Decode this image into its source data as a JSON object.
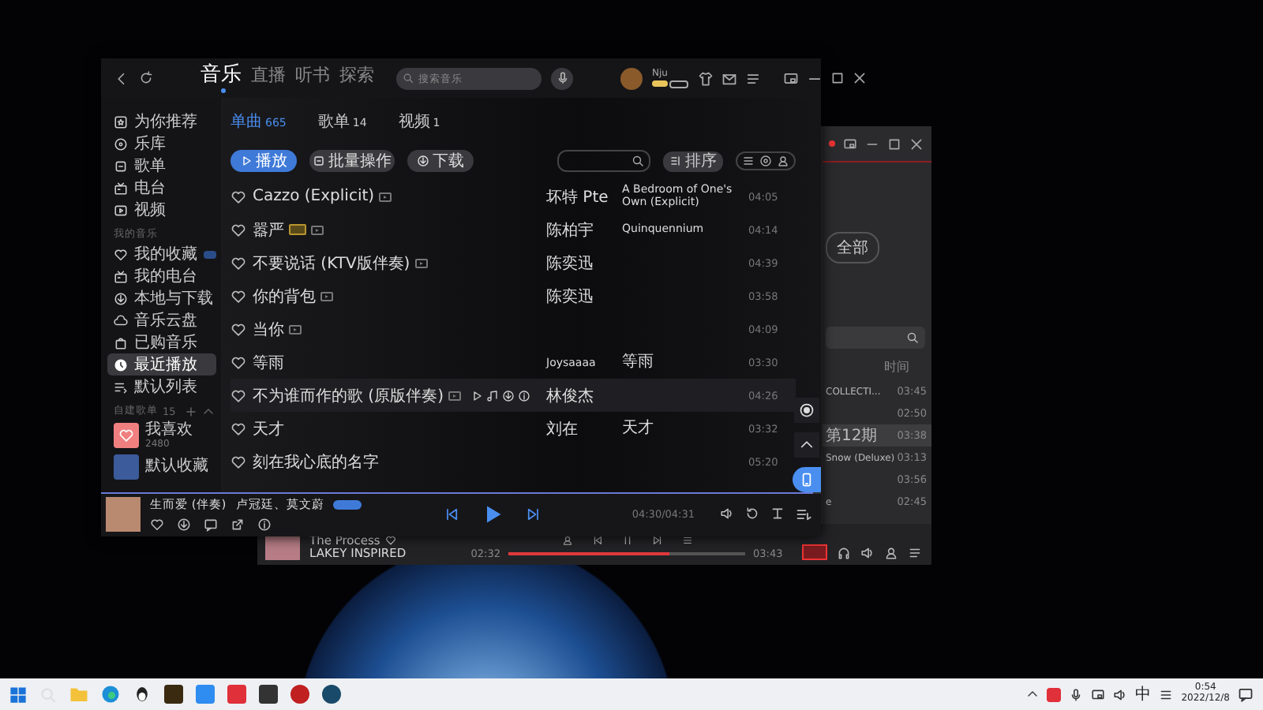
{
  "main_window": {
    "nav_tabs": [
      {
        "label": "音乐",
        "selected": true
      },
      {
        "label": "直播",
        "selected": false
      },
      {
        "label": "听书",
        "selected": false
      },
      {
        "label": "探索",
        "selected": false
      }
    ],
    "search": {
      "placeholder": "搜索音乐"
    },
    "user": {
      "name": "Nju"
    },
    "sidebar": {
      "groups": [
        {
          "items": [
            {
              "label": "为你推荐",
              "kind": "recommend",
              "selected": false
            },
            {
              "label": "乐库",
              "kind": "library",
              "selected": false
            },
            {
              "label": "歌单",
              "kind": "playlist",
              "selected": false
            },
            {
              "label": "电台",
              "kind": "radio",
              "selected": false
            },
            {
              "label": "视频",
              "kind": "video",
              "selected": false
            }
          ]
        },
        {
          "title": "我的音乐",
          "items": [
            {
              "label": "我的收藏",
              "kind": "favorite",
              "selected": false
            },
            {
              "label": "我的电台",
              "kind": "radio",
              "selected": false
            },
            {
              "label": "本地与下载",
              "kind": "download",
              "selected": false
            },
            {
              "label": "音乐云盘",
              "kind": "cloud",
              "selected": false
            },
            {
              "label": "已购音乐",
              "kind": "purchased",
              "selected": false
            },
            {
              "label": "最近播放",
              "kind": "recent",
              "selected": true
            },
            {
              "label": "默认列表",
              "kind": "list",
              "selected": false
            }
          ]
        }
      ],
      "playlists": {
        "title": "自建歌单",
        "count": "15",
        "items": [
          {
            "name": "我喜欢",
            "count": "2480",
            "kind": "liked"
          },
          {
            "name": "默认收藏",
            "kind": "default"
          }
        ]
      }
    },
    "content_tabs": [
      {
        "label": "单曲",
        "count": "665",
        "selected": true
      },
      {
        "label": "歌单",
        "count": "14",
        "selected": false
      },
      {
        "label": "视频",
        "count": "1",
        "selected": false
      }
    ],
    "actions": [
      {
        "label": "播放",
        "kind": "primary"
      },
      {
        "label": "批量操作",
        "kind": "batch"
      },
      {
        "label": "下载",
        "kind": "download"
      }
    ],
    "sort_button": "排序",
    "rows": [
      {
        "title": "Cazzo (Explicit)",
        "mv": true,
        "sq": false,
        "artist": "坏特 Pte",
        "album": "A Bedroom of One's Own (Explicit)",
        "duration": "04:05",
        "hovered": false
      },
      {
        "title": "嚣严",
        "mv": true,
        "sq": true,
        "artist": "陈柏宇",
        "album": "Quinquennium",
        "duration": "04:14",
        "hovered": false
      },
      {
        "title": "不要说话 (KTV版伴奏)",
        "mv": true,
        "sq": false,
        "artist": "陈奕迅",
        "duration": "04:39",
        "hovered": false
      },
      {
        "title": "你的背包",
        "mv": true,
        "sq": false,
        "artist": "陈奕迅",
        "duration": "03:58",
        "hovered": false
      },
      {
        "title": "当你",
        "mv": true,
        "sq": false,
        "duration": "04:09",
        "hovered": false
      },
      {
        "title": "等雨",
        "mv": false,
        "sq": false,
        "artist": "Joysaaaa",
        "album": "等雨",
        "duration": "03:30",
        "hovered": false
      },
      {
        "title": "不为谁而作的歌 (原版伴奏)",
        "mv": true,
        "sq": false,
        "artist": "林俊杰",
        "duration": "04:26",
        "hovered": true
      },
      {
        "title": "天才",
        "mv": false,
        "sq": false,
        "artist": "刘在",
        "album": "天才",
        "duration": "03:32",
        "hovered": false
      },
      {
        "title": "刻在我心底的名字",
        "mv": false,
        "sq": false,
        "duration": "05:20",
        "hovered": false
      }
    ],
    "player": {
      "title": "生而爱 (伴奏)",
      "artist": "卢冠廷、莫文蔚",
      "time": "04:30/04:31",
      "level": 0.99
    }
  },
  "background_window": {
    "filter_button": "全部",
    "column_header": "时间",
    "rows": [
      {
        "text": "COLLECTI...",
        "duration": "03:45",
        "selected": false
      },
      {
        "duration": "02:50",
        "selected": false
      },
      {
        "text": "第12期",
        "duration": "03:38",
        "selected": true
      },
      {
        "text": "Snow (Deluxe)",
        "duration": "03:13",
        "selected": false
      },
      {
        "duration": "03:56",
        "selected": false
      },
      {
        "text": "e",
        "duration": "02:45",
        "selected": false
      }
    ],
    "player": {
      "title": "The Process",
      "artist": "LAKEY INSPIRED",
      "elapsed": "02:32",
      "total": "03:43",
      "level": 0.68
    }
  },
  "taskbar": {
    "input_method": "中",
    "time": "0:54",
    "date": "2022/12/8"
  }
}
